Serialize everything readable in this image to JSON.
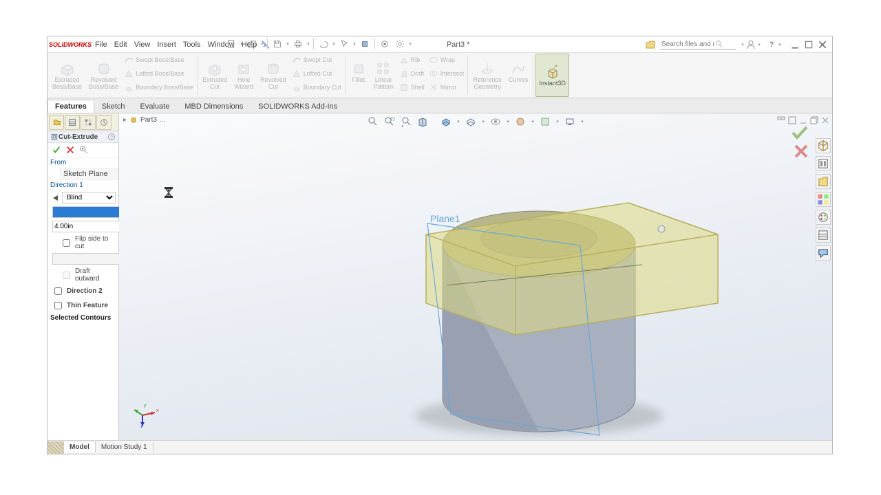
{
  "app": {
    "title": "Part3 *",
    "brand": "SOLIDWORKS"
  },
  "menu": [
    "File",
    "Edit",
    "View",
    "Insert",
    "Tools",
    "Window",
    "Help"
  ],
  "search": {
    "placeholder": "Search files and models"
  },
  "ribbon": {
    "big": [
      {
        "l1": "Extruded",
        "l2": "Boss/Base"
      },
      {
        "l1": "Revolved",
        "l2": "Boss/Base"
      }
    ],
    "boss_small": [
      "Swept Boss/Base",
      "Lofted Boss/Base",
      "Boundary Boss/Base"
    ],
    "cut_big": [
      {
        "l1": "Extruded",
        "l2": "Cut"
      },
      {
        "l1": "Hole",
        "l2": "Wizard"
      },
      {
        "l1": "Revolved",
        "l2": "Cut"
      }
    ],
    "cut_small": [
      "Swept Cut",
      "Lofted Cut",
      "Boundary Cut"
    ],
    "feat_big": [
      {
        "l1": "Fillet",
        "l2": ""
      },
      {
        "l1": "Linear",
        "l2": "Pattern"
      }
    ],
    "feat_small": [
      "Rib",
      "Draft",
      "Shell",
      "Wrap",
      "Intersect",
      "Mirror"
    ],
    "ref_big": [
      {
        "l1": "Reference",
        "l2": "Geometry"
      },
      {
        "l1": "Curves",
        "l2": ""
      }
    ],
    "instant3d": "Instant3D"
  },
  "ribbon_tabs": [
    "Features",
    "Sketch",
    "Evaluate",
    "MBD Dimensions",
    "SOLIDWORKS Add-Ins"
  ],
  "property": {
    "title": "Cut-Extrude",
    "from_label": "From",
    "from_value": "Sketch Plane",
    "dir1_label": "Direction 1",
    "end_cond": "Blind",
    "depth": "4.00in",
    "flip": "Flip side to cut",
    "draft_label": "Draft outward",
    "dir2": "Direction 2",
    "thin": "Thin Feature",
    "contours": "Selected Contours"
  },
  "breadcrumb": {
    "part": "Part3"
  },
  "plane_label": "Plane1",
  "bottom_tabs": [
    "Model",
    "Motion Study 1"
  ]
}
